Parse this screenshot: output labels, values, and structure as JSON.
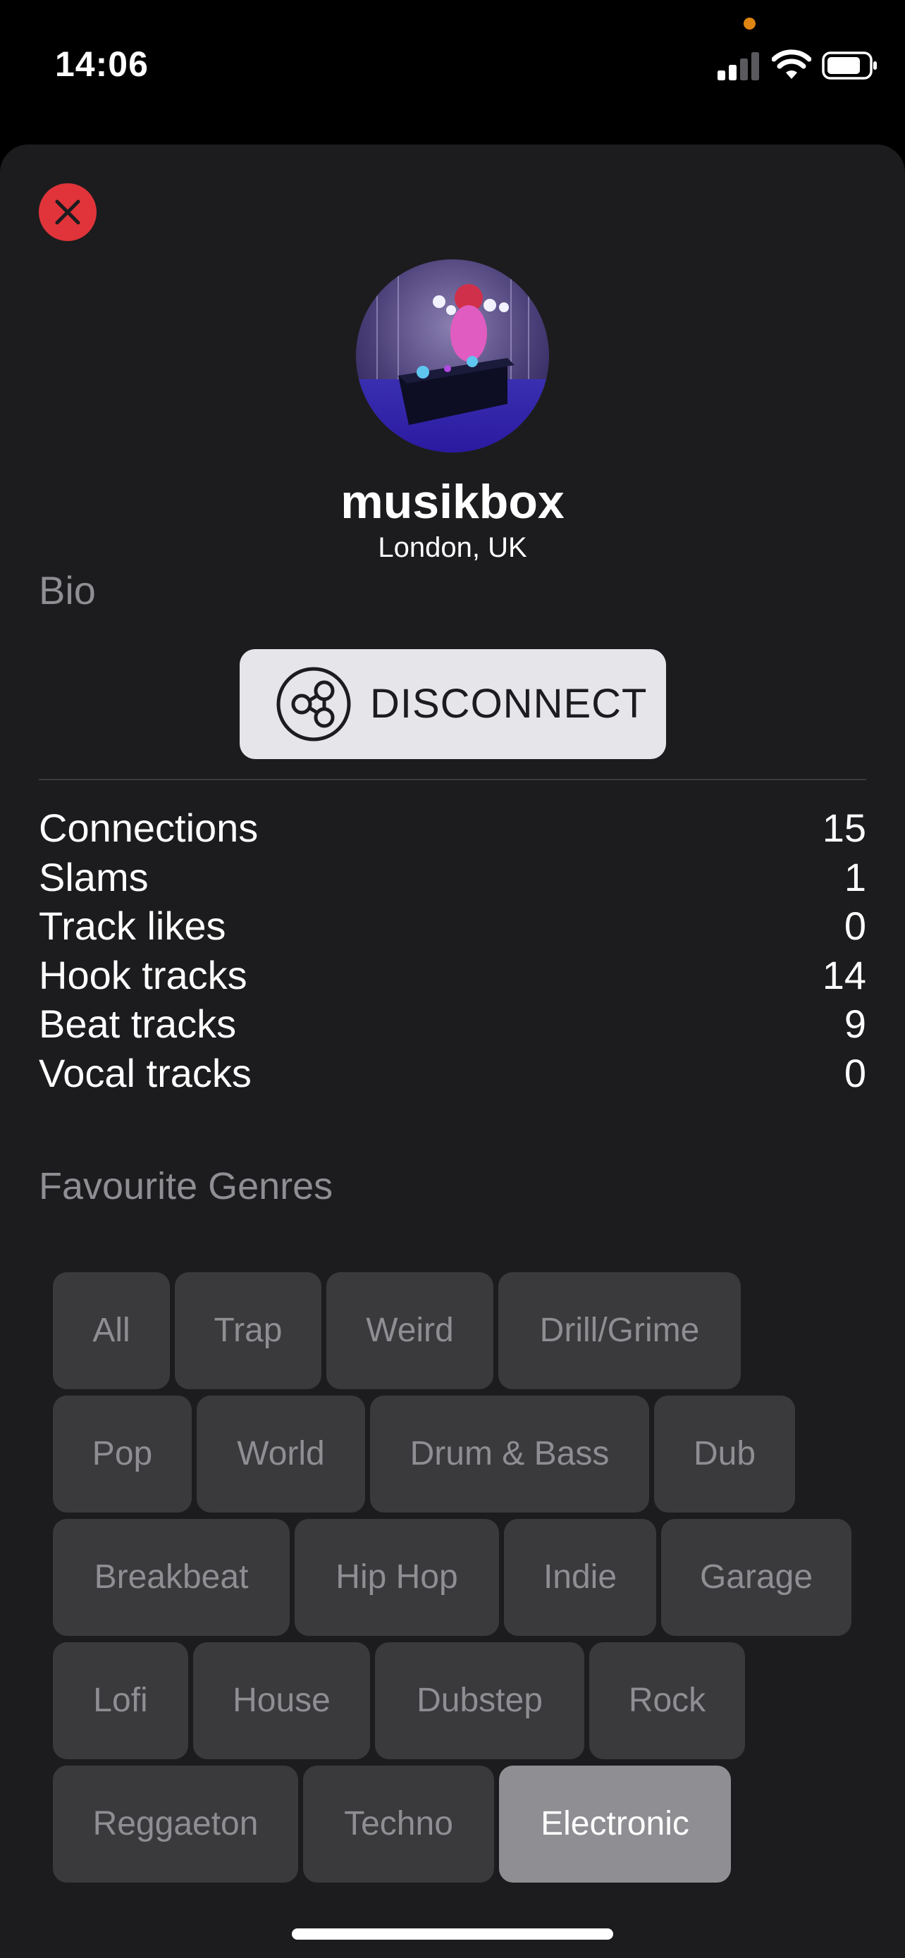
{
  "status_bar": {
    "time": "14:06"
  },
  "profile": {
    "username": "musikbox",
    "location": "London, UK",
    "bio_label": "Bio"
  },
  "actions": {
    "disconnect_label": "DISCONNECT"
  },
  "stats": [
    {
      "label": "Connections",
      "value": "15"
    },
    {
      "label": "Slams",
      "value": "1"
    },
    {
      "label": "Track likes",
      "value": "0"
    },
    {
      "label": "Hook tracks",
      "value": "14"
    },
    {
      "label": "Beat tracks",
      "value": "9"
    },
    {
      "label": "Vocal tracks",
      "value": "0"
    }
  ],
  "genres_section": {
    "title": "Favourite Genres",
    "rows": [
      [
        {
          "label": "All"
        },
        {
          "label": "Trap"
        },
        {
          "label": "Weird"
        },
        {
          "label": "Drill/Grime"
        }
      ],
      [
        {
          "label": "Pop"
        },
        {
          "label": "World"
        },
        {
          "label": "Drum & Bass"
        },
        {
          "label": "Dub"
        }
      ],
      [
        {
          "label": "Breakbeat"
        },
        {
          "label": "Hip Hop"
        },
        {
          "label": "Indie"
        },
        {
          "label": "Garage"
        }
      ],
      [
        {
          "label": "Lofi"
        },
        {
          "label": "House"
        },
        {
          "label": "Dubstep"
        },
        {
          "label": "Rock"
        }
      ],
      [
        {
          "label": "Reggaeton"
        },
        {
          "label": "Techno"
        },
        {
          "label": "Electronic",
          "selected": true
        }
      ]
    ]
  },
  "colors": {
    "background": "#1c1c1e",
    "close_button": "#e0343a",
    "chip": "#3a3a3c",
    "chip_selected": "#8e8e93",
    "privacy_dot": "#e08512"
  }
}
